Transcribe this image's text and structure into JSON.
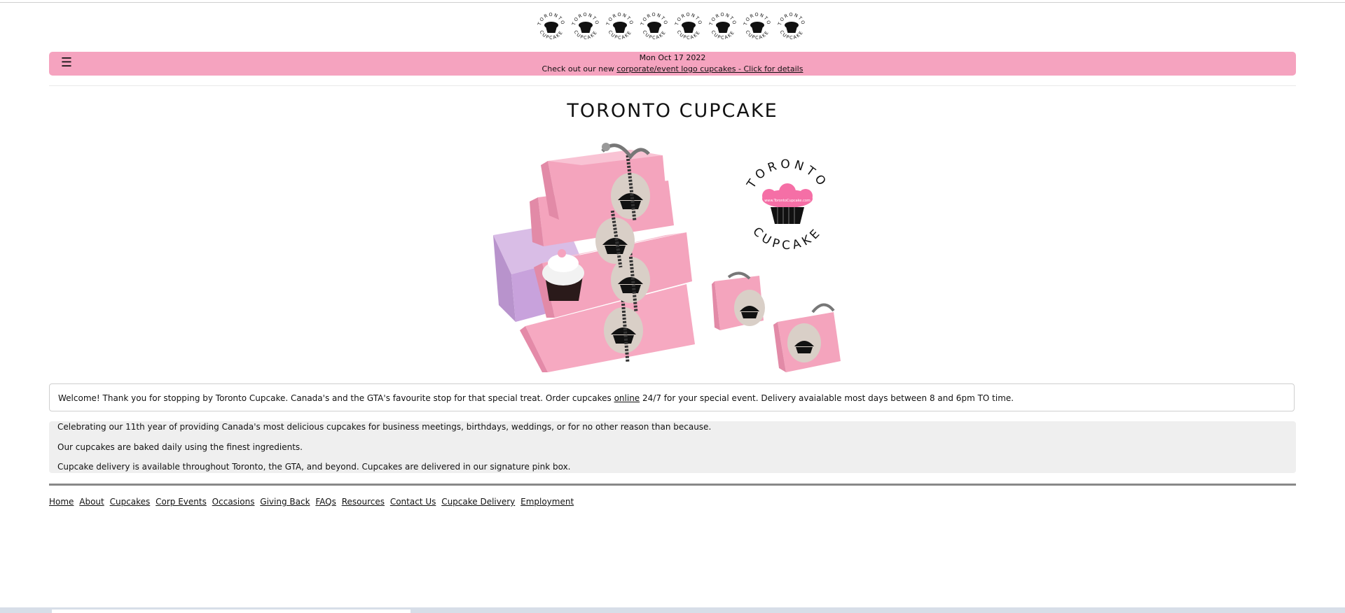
{
  "header": {
    "logo_text": "TORONTO CUPCAKE",
    "logo_count": 8
  },
  "banner": {
    "menu_icon": "☰",
    "date": "Mon Oct 17 2022",
    "promo_prefix": "Check out our new ",
    "promo_link": "corporate/event logo cupcakes - Click for details"
  },
  "page": {
    "title": "TORONTO CUPCAKE"
  },
  "hero": {
    "logo_text": "TORONTO CUPCAKE",
    "logo_url": "www.TorontoCupcake.com"
  },
  "welcome": {
    "before_link": "Welcome! Thank you for stopping by Toronto Cupcake. Canada's and the GTA's favourite stop for that special treat. Order cupcakes ",
    "link": "online",
    "after_link": " 24/7 for your special event. Delivery avaialable most days between 8 and 6pm TO time."
  },
  "info": {
    "lines": [
      "Celebrating our 11th year of providing Canada's most delicious cupcakes for business meetings, birthdays, weddings, or for no other reason than because.",
      "Our cupcakes are baked daily using the finest ingredients.",
      "Cupcake delivery is available throughout Toronto, the GTA, and beyond. Cupcakes are delivered in our signature pink box."
    ]
  },
  "footer": {
    "links": [
      "Home",
      "About",
      "Cupcakes",
      "Corp Events",
      "Occasions",
      "Giving Back",
      "FAQs",
      "Resources",
      "Contact Us",
      "Cupcake Delivery",
      "Employment"
    ]
  },
  "colors": {
    "banner": "#f5a3bf",
    "box_pink": "#f4a4bd",
    "box_lilac": "#c8a2dc",
    "info_bg": "#efefef"
  }
}
